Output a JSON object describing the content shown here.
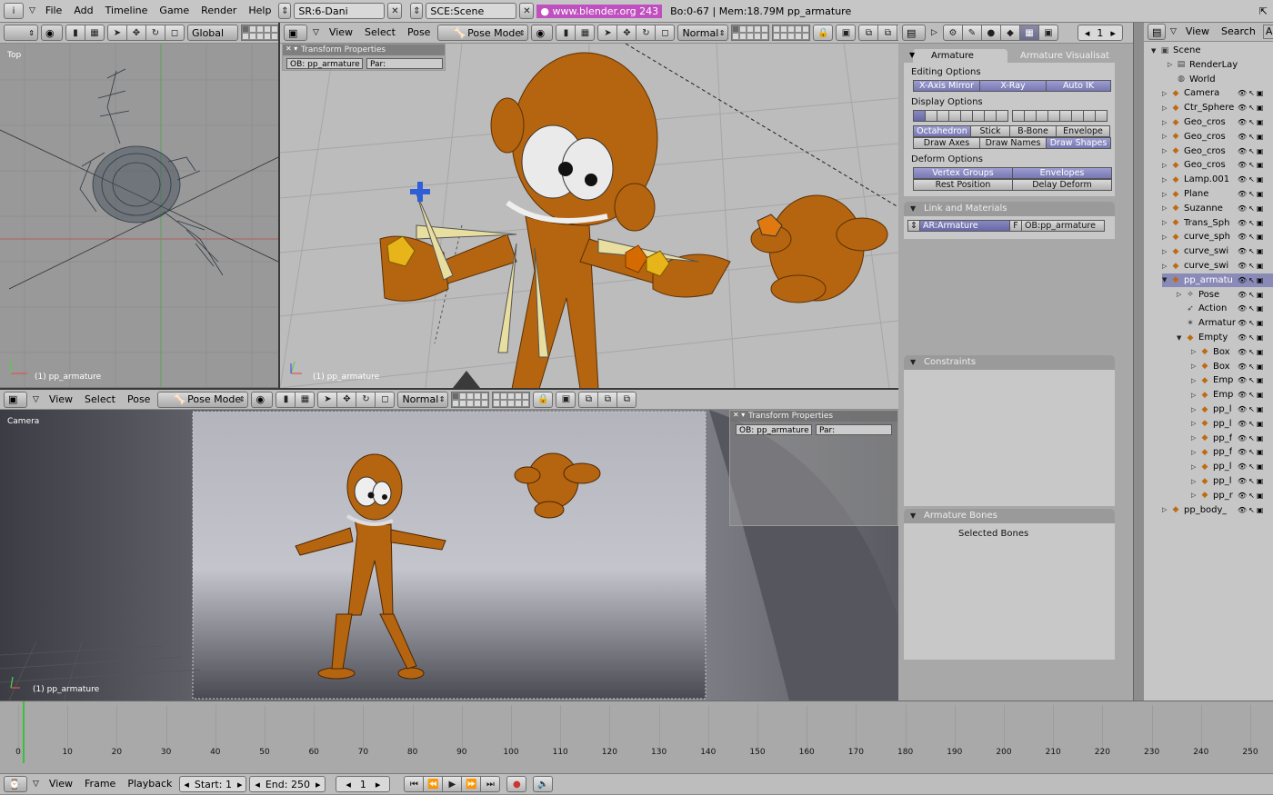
{
  "topbar": {
    "menus": [
      "File",
      "Add",
      "Timeline",
      "Game",
      "Render",
      "Help"
    ],
    "screen_field": "SR:6-Dani",
    "scene_field": "SCE:Scene",
    "url_badge": "www.blender.org 243",
    "stats": "Bo:0-67  |  Mem:18.79M pp_armature"
  },
  "vp_top_left": {
    "header": {
      "orientation": "Global"
    },
    "view_name": "Top",
    "footer": "(1) pp_armature"
  },
  "vp_main": {
    "header": {
      "menus": [
        "View",
        "Select",
        "Pose"
      ],
      "mode": "Pose Mode",
      "draw": "Normal"
    },
    "transform_title": "Transform Properties",
    "ob_field": "OB: pp_armature",
    "par_field": "Par:",
    "footer": "(1) pp_armature"
  },
  "vp_camera": {
    "header": {
      "menus": [
        "View",
        "Select",
        "Pose"
      ],
      "mode": "Pose Mode",
      "draw": "Normal"
    },
    "view_name": "Camera",
    "transform_title": "Transform Properties",
    "ob_field": "OB: pp_armature",
    "par_field": "Par:",
    "footer": "(1) pp_armature"
  },
  "buttons": {
    "frame_field": "1",
    "tabs": [
      "Armature",
      "Armature Visualisat"
    ],
    "editing_label": "Editing Options",
    "editing_buttons": [
      "X-Axis Mirror",
      "X-Ray",
      "Auto IK"
    ],
    "display_label": "Display Options",
    "display_row1": [
      "Octahedron",
      "Stick",
      "B-Bone",
      "Envelope"
    ],
    "display_row2": [
      "Draw Axes",
      "Draw Names",
      "Draw Shapes"
    ],
    "deform_label": "Deform Options",
    "deform_row1": [
      "Vertex Groups",
      "Envelopes"
    ],
    "deform_row2": [
      "Rest Position",
      "Delay Deform"
    ],
    "link_title": "Link and Materials",
    "ar_field": "AR:Armature",
    "f_label": "F",
    "ob_field": "OB:pp_armature",
    "constraints_title": "Constraints",
    "bones_title": "Armature Bones",
    "selected_bones": "Selected Bones"
  },
  "outliner": {
    "menus": [
      "View",
      "Search",
      "All"
    ],
    "items": [
      {
        "name": "Scene",
        "icon": "scene-icon"
      },
      {
        "name": "RenderLay",
        "icon": "renderlayer-icon"
      },
      {
        "name": "World",
        "icon": "world-icon"
      },
      {
        "name": "Camera",
        "icon": "object-icon"
      },
      {
        "name": "Ctr_Sphere",
        "icon": "object-icon"
      },
      {
        "name": "Geo_cros",
        "icon": "object-icon"
      },
      {
        "name": "Geo_cros",
        "icon": "object-icon"
      },
      {
        "name": "Geo_cros",
        "icon": "object-icon"
      },
      {
        "name": "Geo_cros",
        "icon": "object-icon"
      },
      {
        "name": "Lamp.001",
        "icon": "object-icon"
      },
      {
        "name": "Plane",
        "icon": "object-icon"
      },
      {
        "name": "Suzanne",
        "icon": "object-icon"
      },
      {
        "name": "Trans_Sph",
        "icon": "object-icon"
      },
      {
        "name": "curve_sph",
        "icon": "object-icon"
      },
      {
        "name": "curve_swi",
        "icon": "object-icon"
      },
      {
        "name": "curve_swi",
        "icon": "object-icon"
      },
      {
        "name": "pp_armatu",
        "icon": "object-icon"
      },
      {
        "name": "Pose",
        "icon": "pose-icon"
      },
      {
        "name": "Action",
        "icon": "action-icon"
      },
      {
        "name": "Armatur",
        "icon": "armature-icon"
      },
      {
        "name": "Empty",
        "icon": "object-icon"
      },
      {
        "name": "Box",
        "icon": "object-icon"
      },
      {
        "name": "Box",
        "icon": "object-icon"
      },
      {
        "name": "Emp",
        "icon": "object-icon"
      },
      {
        "name": "Emp",
        "icon": "object-icon"
      },
      {
        "name": "pp_l",
        "icon": "object-icon"
      },
      {
        "name": "pp_l",
        "icon": "object-icon"
      },
      {
        "name": "pp_f",
        "icon": "object-icon"
      },
      {
        "name": "pp_f",
        "icon": "object-icon"
      },
      {
        "name": "pp_l",
        "icon": "object-icon"
      },
      {
        "name": "pp_l",
        "icon": "object-icon"
      },
      {
        "name": "pp_r",
        "icon": "object-icon"
      },
      {
        "name": "pp_body_",
        "icon": "object-icon"
      }
    ]
  },
  "timeline": {
    "ticks": [
      "0",
      "10",
      "20",
      "30",
      "40",
      "50",
      "60",
      "70",
      "80",
      "90",
      "100",
      "110",
      "120",
      "130",
      "140",
      "150",
      "160",
      "170",
      "180",
      "190",
      "200",
      "210",
      "220",
      "230",
      "240",
      "250"
    ],
    "menus": [
      "View",
      "Frame",
      "Playback"
    ],
    "start": "Start: 1",
    "end": "End: 250",
    "current_frame": "1"
  },
  "colors": {
    "accent_blue": "#7878b4",
    "selection_pink": "#c050c0",
    "character_orange": "#b5650f"
  }
}
